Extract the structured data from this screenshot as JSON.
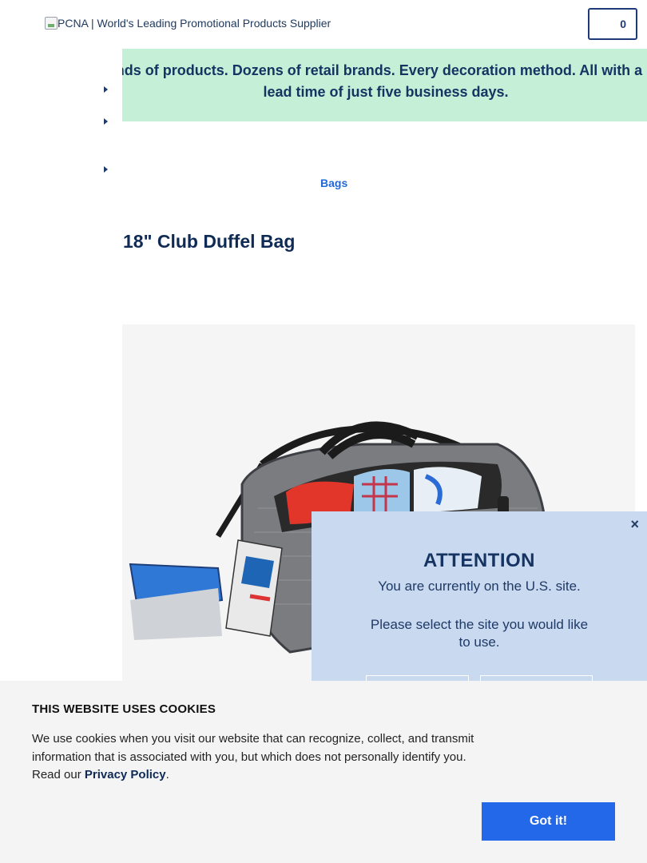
{
  "header": {
    "logo_alt": "PCNA | World's Leading Promotional Products Supplier",
    "cart_count": "0"
  },
  "banner": {
    "text": "Thousands of products. Dozens of retail brands. Every decoration method. All with a standard lead time of just five business days."
  },
  "breadcrumb": {
    "label": "Bags"
  },
  "product": {
    "title": "18\" Club Duffel Bag"
  },
  "attention_modal": {
    "title": "ATTENTION",
    "line1": "You are currently on the U.S. site.",
    "line2": "Please select the site you would like to use.",
    "close": "×"
  },
  "cookie_banner": {
    "title": "THIS WEBSITE USES COOKIES",
    "body_prefix": "We use cookies when you visit our website that can recognize, collect, and transmit information that is associated with you, but which does not personally identify you. Read our ",
    "privacy_link": "Privacy Policy",
    "body_suffix": ".",
    "button": "Got it!"
  },
  "colors": {
    "banner_bg": "#c6efd7",
    "navy": "#163462",
    "link_blue": "#1f6ad6",
    "button_blue": "#2468ea",
    "modal_bg": "#c9d9ef",
    "cookie_bg": "#f4f4f4"
  }
}
